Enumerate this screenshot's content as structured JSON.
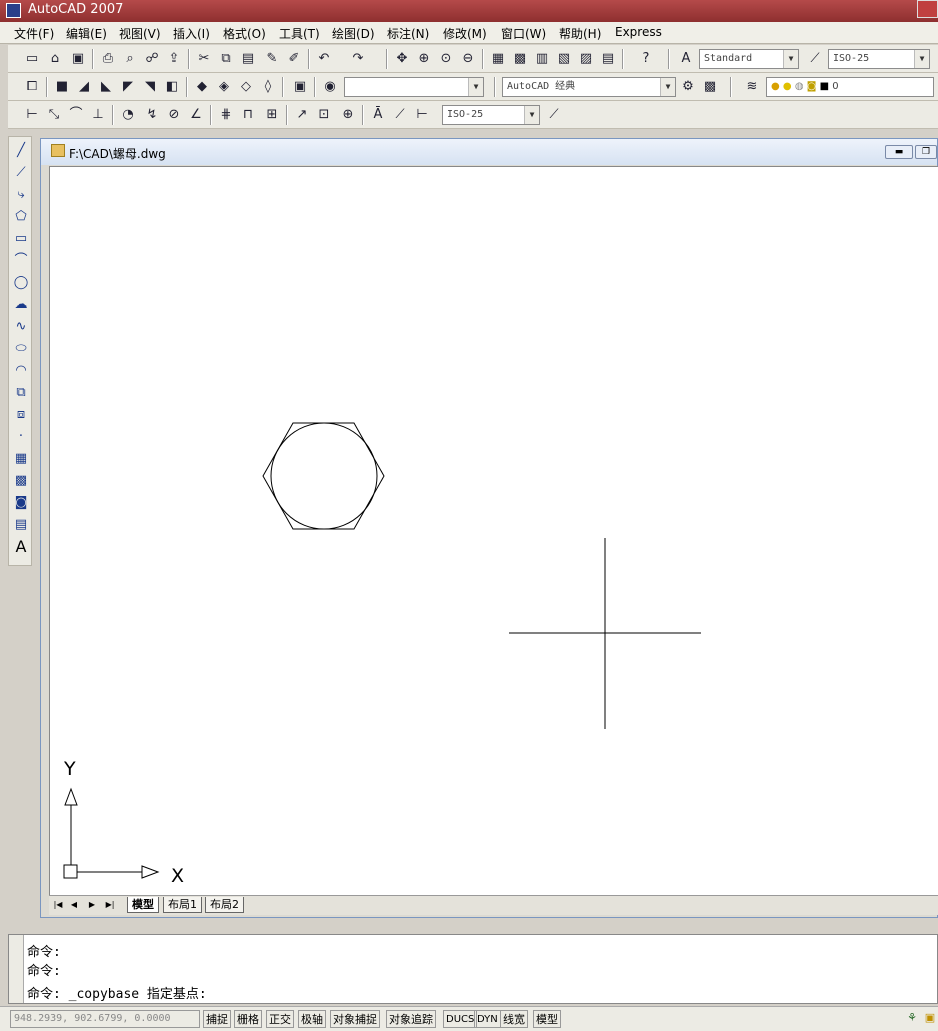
{
  "app": {
    "title": "AutoCAD 2007"
  },
  "menu": [
    "文件(F)",
    "编辑(E)",
    "视图(V)",
    "插入(I)",
    "格式(O)",
    "工具(T)",
    "绘图(D)",
    "标注(N)",
    "修改(M)",
    "窗口(W)",
    "帮助(H)",
    "Express"
  ],
  "toolbar": {
    "text_style": "Standard",
    "dim_style": "ISO-25",
    "workspace": "AutoCAD 经典",
    "layer_value": "0",
    "dim_style_2": "ISO-25",
    "view_combo": ""
  },
  "document": {
    "title": "F:\\CAD\\螺母.dwg"
  },
  "ucs": {
    "x_label": "X",
    "y_label": "Y"
  },
  "layout_tabs": [
    "模型",
    "布局1",
    "布局2"
  ],
  "command": {
    "lines": [
      "命令:",
      "命令:",
      "命令: _copybase 指定基点:"
    ]
  },
  "status": {
    "coords": "948.2939,   902.6799, 0.0000",
    "buttons": [
      "捕捉",
      "栅格",
      "正交",
      "极轴",
      "对象捕捉",
      "对象追踪",
      "DUCS",
      "DYN",
      "线宽",
      "模型"
    ]
  },
  "icons": {
    "draw_tools": [
      "line-icon",
      "construction-line-icon",
      "polyline-icon",
      "polygon-icon",
      "rectangle-icon",
      "arc-icon",
      "circle-icon",
      "revision-cloud-icon",
      "spline-icon",
      "ellipse-icon",
      "ellipse-arc-icon",
      "insert-block-icon",
      "make-block-icon",
      "point-icon",
      "hatch-icon",
      "gradient-icon",
      "region-icon",
      "table-icon",
      "multiline-text-icon"
    ]
  }
}
